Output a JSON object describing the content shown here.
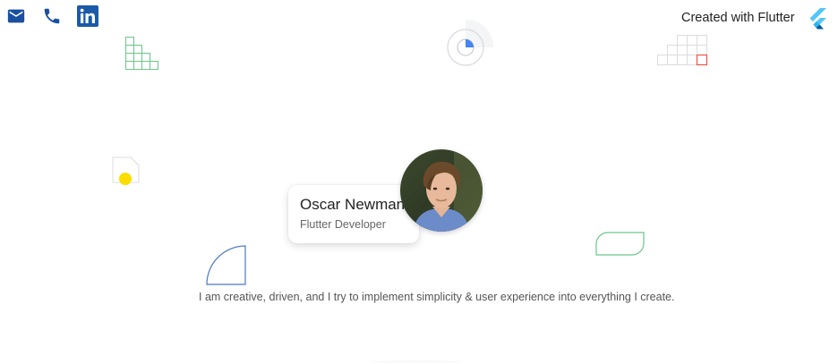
{
  "contacts": {
    "email_icon": "mail-icon",
    "phone_icon": "phone-icon",
    "linkedin_icon": "linkedin-icon",
    "linkedin_glyph": "in"
  },
  "brand": {
    "created_with": "Created with Flutter",
    "logo_icon": "flutter-logo-icon"
  },
  "profile": {
    "name": "Oscar Newman",
    "role": "Flutter Developer"
  },
  "bio": "I am creative, driven, and I try to implement simplicity & user experience into everything I create.",
  "colors": {
    "icon_blue": "#1a4fa0",
    "linkedin_blue": "#0a66c2",
    "flutter_light": "#54c5f8",
    "flutter_dark": "#01579b",
    "deco_green": "#34a853",
    "deco_blue": "#4285f4",
    "deco_red": "#ea4335",
    "deco_yellow": "#fbdd00",
    "deco_gray": "#d0d0d0"
  }
}
